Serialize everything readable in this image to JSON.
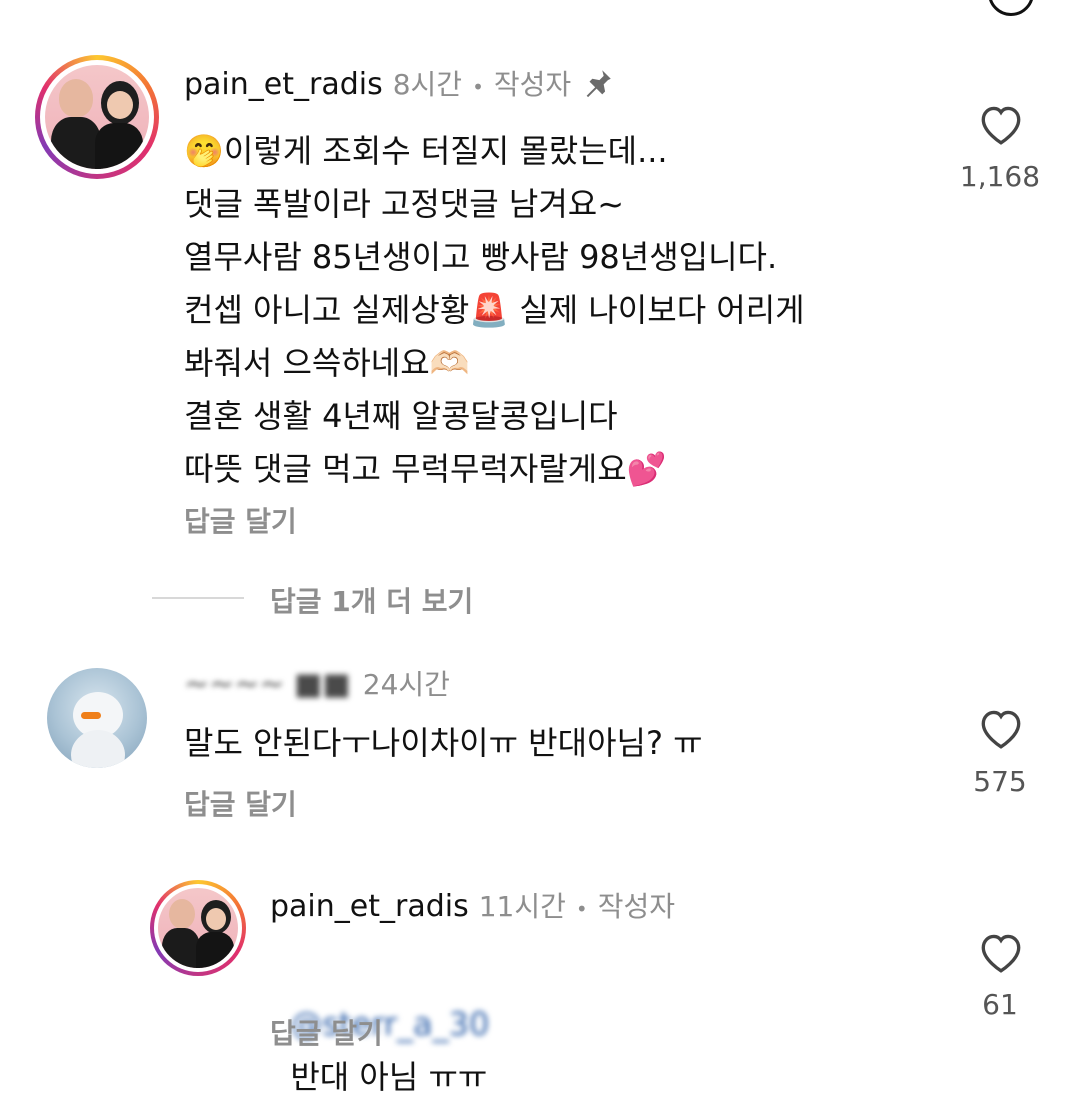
{
  "comments": [
    {
      "username": "pain_et_radis",
      "time": "8시간",
      "dot": "•",
      "author_badge": "작성자",
      "pinned": true,
      "lines": [
        "🤭이렇게 조회수 터질지 몰랐는데...",
        "댓글 폭발이라 고정댓글 남겨요~",
        "열무사람 85년생이고 빵사람 98년생입니다.",
        "컨셉 아니고 실제상황🚨 실제 나이보다 어리게",
        "봐줘서 으쓱하네요🫶🏻",
        "결혼 생활 4년째 알콩달콩입니다",
        "따뜻 댓글 먹고 무럭무럭자랄게요💕"
      ],
      "reply_label": "답글 달기",
      "likes": "1,168",
      "more_replies": "답글 1개 더 보기"
    },
    {
      "username_blurred": "~~~~ ■■",
      "time": "24시간",
      "text": "말도 안된다ㅜ나이차이ㅠ 반대아님? ㅠ",
      "reply_label": "답글 달기",
      "likes": "575"
    },
    {
      "username": "pain_et_radis",
      "time": "11시간",
      "dot": "•",
      "author_badge": "작성자",
      "mention_blurred": "@sterr_a_30",
      "text": "반대 아님 ㅠㅠ",
      "reply_label": "답글 달기",
      "likes": "61"
    }
  ],
  "icons": {
    "heart": "heart-outline-icon",
    "pin": "pin-icon"
  },
  "colors": {
    "secondary_text": "#8e8e8e",
    "mention": "#2b5ea8",
    "story_ring": "#e1306c"
  }
}
